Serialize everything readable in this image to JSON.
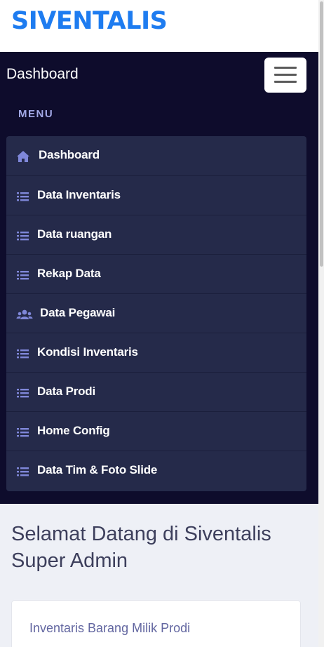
{
  "app": {
    "brand": "SIVENTALIS"
  },
  "navbar": {
    "title": "Dashboard",
    "toggle_icon": "hamburger-icon"
  },
  "sidebar": {
    "section_label": "MENU",
    "items": [
      {
        "label": "Dashboard",
        "icon": "home-icon"
      },
      {
        "label": "Data Inventaris",
        "icon": "list-icon"
      },
      {
        "label": "Data ruangan",
        "icon": "list-icon"
      },
      {
        "label": "Rekap Data",
        "icon": "list-icon"
      },
      {
        "label": "Data Pegawai",
        "icon": "users-icon"
      },
      {
        "label": "Kondisi Inventaris",
        "icon": "list-icon"
      },
      {
        "label": "Data Prodi",
        "icon": "list-icon"
      },
      {
        "label": "Home Config",
        "icon": "list-icon"
      },
      {
        "label": "Data Tim & Foto Slide",
        "icon": "list-icon"
      }
    ]
  },
  "main": {
    "welcome": "Selamat Datang di Siventalis Super Admin",
    "card_title": "Inventaris Barang Milik Prodi"
  },
  "colors": {
    "brand": "#1e7cf0",
    "nav_bg": "#0e0c2c",
    "menu_bg": "#252a4a",
    "icon": "#7f87d9"
  }
}
